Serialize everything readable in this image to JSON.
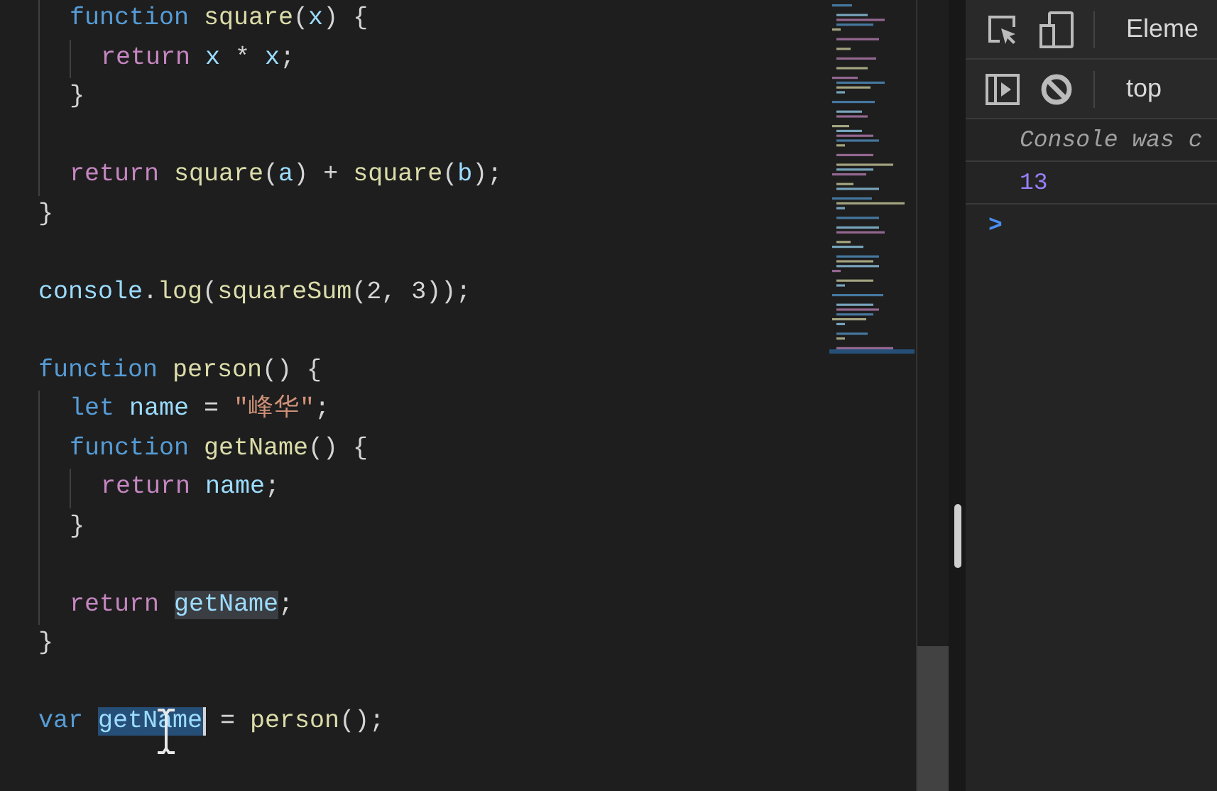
{
  "editor": {
    "lines": [
      {
        "kind": "block",
        "children": [
          {
            "kind": "code",
            "tokens": [
              {
                "kind": "keyword",
                "text": "function "
              },
              {
                "kind": "fn",
                "text": "square"
              },
              {
                "kind": "plain",
                "text": "("
              },
              {
                "kind": "var",
                "text": "x"
              },
              {
                "kind": "plain",
                "text": ") {"
              }
            ],
            "children": [
              {
                "kind": "code",
                "tokens": [
                  {
                    "kind": "control",
                    "text": "return "
                  },
                  {
                    "kind": "var",
                    "text": "x"
                  },
                  {
                    "kind": "plain",
                    "text": " * "
                  },
                  {
                    "kind": "var",
                    "text": "x"
                  },
                  {
                    "kind": "plain",
                    "text": ";"
                  }
                ]
              }
            ]
          },
          {
            "kind": "code",
            "tokens": [
              {
                "kind": "plain",
                "text": "}"
              }
            ]
          },
          {
            "kind": "blank"
          },
          {
            "kind": "code",
            "tokens": [
              {
                "kind": "control",
                "text": "return "
              },
              {
                "kind": "fn",
                "text": "square"
              },
              {
                "kind": "plain",
                "text": "("
              },
              {
                "kind": "var",
                "text": "a"
              },
              {
                "kind": "plain",
                "text": ") + "
              },
              {
                "kind": "fn",
                "text": "square"
              },
              {
                "kind": "plain",
                "text": "("
              },
              {
                "kind": "var",
                "text": "b"
              },
              {
                "kind": "plain",
                "text": ");"
              }
            ]
          }
        ]
      },
      {
        "kind": "code",
        "tokens": [
          {
            "kind": "plain",
            "text": "}"
          }
        ]
      },
      {
        "kind": "blank"
      },
      {
        "kind": "code",
        "tokens": [
          {
            "kind": "var",
            "text": "console"
          },
          {
            "kind": "plain",
            "text": "."
          },
          {
            "kind": "fn",
            "text": "log"
          },
          {
            "kind": "plain",
            "text": "("
          },
          {
            "kind": "fn",
            "text": "squareSum"
          },
          {
            "kind": "plain",
            "text": "("
          },
          {
            "kind": "number",
            "text": "2"
          },
          {
            "kind": "plain",
            "text": ", "
          },
          {
            "kind": "number",
            "text": "3"
          },
          {
            "kind": "plain",
            "text": "));"
          }
        ]
      },
      {
        "kind": "blank"
      },
      {
        "kind": "code",
        "tokens": [
          {
            "kind": "keyword",
            "text": "function "
          },
          {
            "kind": "fn",
            "text": "person"
          },
          {
            "kind": "plain",
            "text": "() {"
          }
        ],
        "children": [
          {
            "kind": "code",
            "tokens": [
              {
                "kind": "keyword",
                "text": "let "
              },
              {
                "kind": "var",
                "text": "name"
              },
              {
                "kind": "plain",
                "text": " = "
              },
              {
                "kind": "string",
                "text": "\"峰华\""
              },
              {
                "kind": "plain",
                "text": ";"
              }
            ]
          },
          {
            "kind": "code",
            "tokens": [
              {
                "kind": "keyword",
                "text": "function "
              },
              {
                "kind": "fn",
                "text": "getName"
              },
              {
                "kind": "plain",
                "text": "() {"
              }
            ],
            "children": [
              {
                "kind": "code",
                "tokens": [
                  {
                    "kind": "control",
                    "text": "return "
                  },
                  {
                    "kind": "var",
                    "text": "name"
                  },
                  {
                    "kind": "plain",
                    "text": ";"
                  }
                ]
              }
            ]
          },
          {
            "kind": "code",
            "tokens": [
              {
                "kind": "plain",
                "text": "}"
              }
            ]
          },
          {
            "kind": "blank"
          },
          {
            "kind": "code",
            "tokens": [
              {
                "kind": "control",
                "text": "return "
              },
              {
                "kind": "var",
                "text": "getName",
                "highlighted": true
              },
              {
                "kind": "plain",
                "text": ";"
              }
            ]
          }
        ]
      },
      {
        "kind": "code",
        "tokens": [
          {
            "kind": "plain",
            "text": "}"
          }
        ]
      },
      {
        "kind": "blank"
      },
      {
        "kind": "code",
        "tokens": [
          {
            "kind": "keyword",
            "text": "var "
          },
          {
            "kind": "var",
            "text": "getName",
            "selection": true
          },
          {
            "kind": "plain",
            "text": " = "
          },
          {
            "kind": "fn",
            "text": "person"
          },
          {
            "kind": "plain",
            "text": "();"
          }
        ]
      }
    ]
  },
  "devtools": {
    "toolbar_tab": "Eleme",
    "context": "top",
    "console": [
      {
        "kind": "info",
        "text": "Console was c"
      },
      {
        "kind": "result",
        "text": "13"
      },
      {
        "kind": "prompt",
        "text": ">"
      }
    ]
  }
}
